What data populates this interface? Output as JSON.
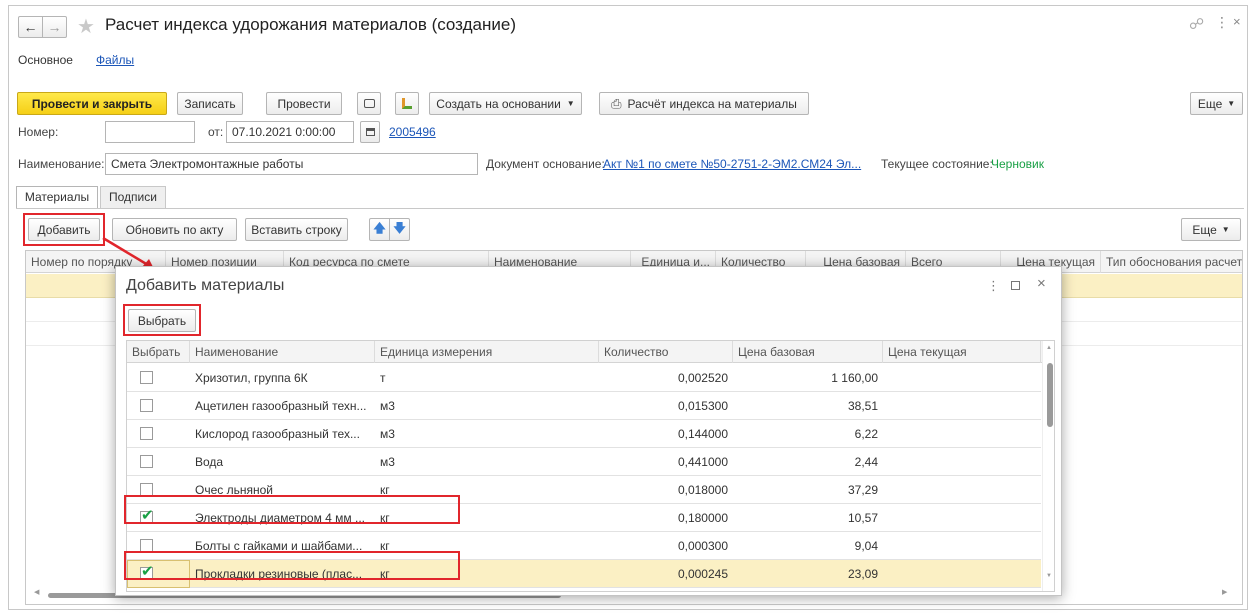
{
  "window": {
    "title": "Расчет индекса удорожания материалов (создание)",
    "tabs": [
      "Основное",
      "Файлы"
    ]
  },
  "toolbar": {
    "post_close": "Провести и закрыть",
    "write": "Записать",
    "post": "Провести",
    "create_based": "Создать на основании",
    "index_calc": "Расчёт индекса на материалы",
    "more": "Еще"
  },
  "form": {
    "number_label": "Номер:",
    "number_value": "",
    "date_label": "от:",
    "date_value": "07.10.2021 0:00:00",
    "doc_link": "2005496",
    "name_label": "Наименование:",
    "name_value": "Смета Электромонтажные работы",
    "base_doc_label": "Документ основание:",
    "base_doc_value": "Акт №1 по смете №50-2751-2-ЭМ2.СМ24 Эл...",
    "state_label": "Текущее состояние:",
    "state_value": "Черновик"
  },
  "subtabs": [
    "Материалы",
    "Подписи"
  ],
  "table_toolbar": {
    "add": "Добавить",
    "refresh": "Обновить по акту",
    "insert": "Вставить строку",
    "more": "Еще"
  },
  "main_table": {
    "columns": [
      "Номер по порядку",
      "Номер позиции",
      "Код ресурса по смете",
      "Наименование",
      "Единица и...",
      "Количество",
      "Цена базовая",
      "Всего",
      "Цена текущая",
      "Тип обоснования расчета"
    ]
  },
  "dialog": {
    "title": "Добавить материалы",
    "select_button": "Выбрать",
    "columns": [
      "Выбрать",
      "Наименование",
      "Единица измерения",
      "Количество",
      "Цена базовая",
      "Цена текущая"
    ],
    "rows": [
      {
        "checked": false,
        "name": "Хризотил, группа 6К",
        "unit": "т",
        "qty": "0,002520",
        "price": "1 160,00",
        "current": ""
      },
      {
        "checked": false,
        "name": "Ацетилен газообразный техн...",
        "unit": "м3",
        "qty": "0,015300",
        "price": "38,51",
        "current": ""
      },
      {
        "checked": false,
        "name": "Кислород газообразный тех...",
        "unit": "м3",
        "qty": "0,144000",
        "price": "6,22",
        "current": ""
      },
      {
        "checked": false,
        "name": "Вода",
        "unit": "м3",
        "qty": "0,441000",
        "price": "2,44",
        "current": ""
      },
      {
        "checked": false,
        "name": "Очес льняной",
        "unit": "кг",
        "qty": "0,018000",
        "price": "37,29",
        "current": ""
      },
      {
        "checked": true,
        "name": "Электроды диаметром 4 мм ...",
        "unit": "кг",
        "qty": "0,180000",
        "price": "10,57",
        "current": ""
      },
      {
        "checked": false,
        "name": "Болты с гайками и шайбами...",
        "unit": "кг",
        "qty": "0,000300",
        "price": "9,04",
        "current": ""
      },
      {
        "checked": true,
        "name": "Прокладки резиновые (плас...",
        "unit": "кг",
        "qty": "0,000245",
        "price": "23,09",
        "current": ""
      }
    ]
  },
  "colors": {
    "accent_yellow": "#f5cf16",
    "link": "#1c56b8",
    "highlight": "#e1262c",
    "selected_row": "#fbf0c4"
  }
}
